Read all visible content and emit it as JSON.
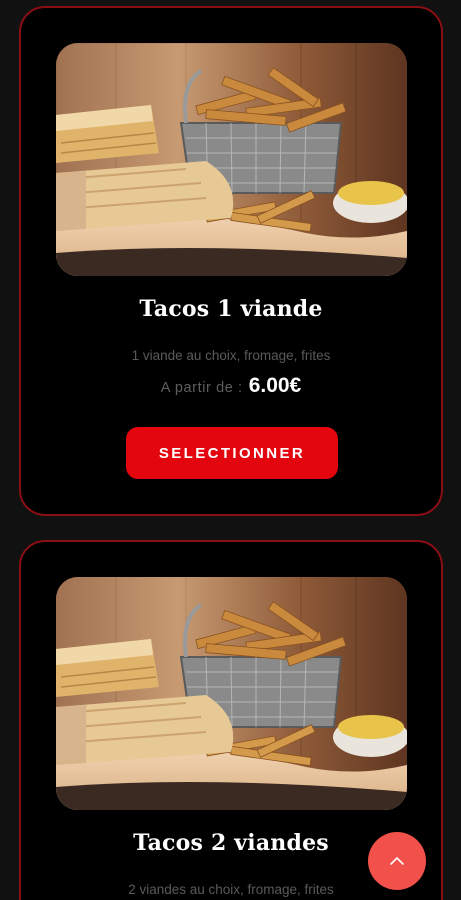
{
  "products": [
    {
      "title": "Tacos 1 viande",
      "description": "1 viande au choix, fromage, frites",
      "price_label": "A partir de :",
      "price": "6.00€",
      "button_label": "SELECTIONNER",
      "image_icon": "tacos-fries-photo"
    },
    {
      "title": "Tacos 2 viandes",
      "description": "2 viandes au choix, fromage, frites",
      "image_icon": "tacos-fries-photo"
    }
  ],
  "scroll_top_icon": "chevron-up-icon",
  "colors": {
    "background": "#111111",
    "card": "#000000",
    "card_border": "#8a0f14",
    "button": "#e4060f",
    "scroll_top": "#f2504b"
  }
}
